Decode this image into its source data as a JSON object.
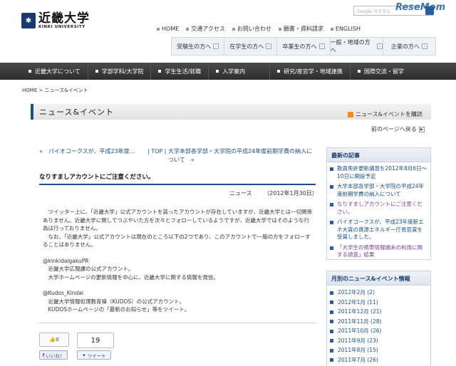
{
  "header": {
    "logo_jp": "近畿大学",
    "logo_en": "KINKI UNIVERSITY",
    "search_placeholder": "Google カスタム",
    "watermark": "ReseMom",
    "topnav": [
      "HOME",
      "交通アクセス",
      "お問い合わせ",
      "願書・資料請求",
      "ENGLISH"
    ],
    "quicknav": [
      "受験生の方へ",
      "在学生の方へ",
      "卒業生の方へ",
      "一般・地域の方へ",
      "企業の方へ"
    ]
  },
  "mainnav": [
    "近畿大学について",
    "学部学科/大学院",
    "学生生活/就職",
    "入学案内",
    "研究/産官学・地域連携",
    "国際交流・留学"
  ],
  "breadcrumb": "HOME > ニュース&イベント",
  "page_title": "ニュース&イベント",
  "rss_label": "ニュース&イベントを購読",
  "prev_page": "前のページへ戻る",
  "article_nav": {
    "prev": "«　パイオコークスが、平成23年度...",
    "top": "| TOP |",
    "next": "大学本部各学部・大学院の平成24年度前期学費の納入について　»"
  },
  "article": {
    "title": "なりすましアカウントにご注意ください。",
    "category": "ニュース",
    "date": "（2012年1月30日）",
    "para1": "　ツイッター上に、「近畿大学」公式アカウントを装ったアカウントが存在していますが、近畿大学とは一切関係ありません。近畿大学に関してつぶやいた方を次々とフォローしているようですが、近畿大学ではそのような行為は行っておりません。",
    "para2": "　なお、「近畿大学」公式アカウントは現在のところ以下の2つであり、このアカウントで一般の方をフォローすることはありません。",
    "acct1_name": "@kinkidaigakuPR",
    "acct1_l1": "　近畿大学広報課の公式アカウント。",
    "acct1_l2": "　大学ホームページの更新情報を中心に、近畿大学に関する情報を発信。",
    "acct2_name": "@Kudos_Kindai",
    "acct2_l1": "　近畿大学情報処理教育棟（KUDOS）の公式アカウント。",
    "acct2_l2": "　KUDOSホームページの「最新のお知らせ」等をツイート。"
  },
  "social": {
    "like_count": "0",
    "tweet_count": "19",
    "like_label": "いいね！",
    "tweet_label": "ツイート"
  },
  "sidebar": {
    "recent_title": "最新の記事",
    "recent": [
      "教員免許更新講習を2012年8月6日〜10日に開設予定",
      "大学本部各学部・大学院の平成24年度前期学費の納入について",
      "なりすましアカウントにご注意ください。",
      "パイオコークスが、平成23年度新エネ大賞の資源エネルギー庁長官賞を受賞しました。",
      "「大学生の携帯情報端末の利用に関する調査」結果"
    ],
    "monthly_title": "月別のニュース&イベント情報",
    "monthly": [
      "2012年2月 (2)",
      "2012年1月 (11)",
      "2011年12月 (21)",
      "2011年11月 (28)",
      "2011年10月 (26)",
      "2011年9月 (23)",
      "2011年8月 (15)",
      "2011年7月 (26)"
    ]
  }
}
